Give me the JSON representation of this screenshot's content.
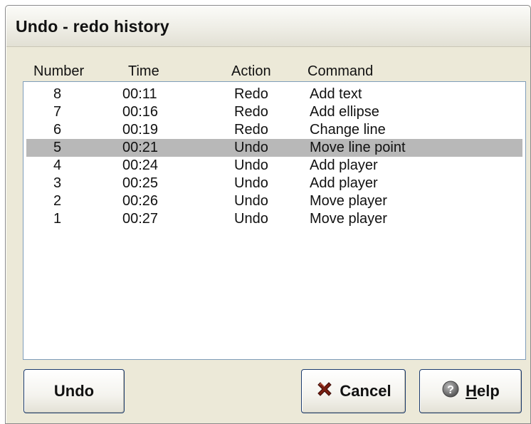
{
  "dialog": {
    "title": "Undo - redo history"
  },
  "columns": {
    "number": "Number",
    "time": "Time",
    "action": "Action",
    "command": "Command"
  },
  "rows": [
    {
      "number": "8",
      "time": "00:11",
      "action": "Redo",
      "command": "Add text"
    },
    {
      "number": "7",
      "time": "00:16",
      "action": "Redo",
      "command": "Add ellipse"
    },
    {
      "number": "6",
      "time": "00:19",
      "action": "Redo",
      "command": "Change line"
    },
    {
      "number": "5",
      "time": "00:21",
      "action": "Undo",
      "command": "Move line point",
      "selected": true
    },
    {
      "number": "4",
      "time": "00:24",
      "action": "Undo",
      "command": "Add player"
    },
    {
      "number": "3",
      "time": "00:25",
      "action": "Undo",
      "command": "Add player"
    },
    {
      "number": "2",
      "time": "00:26",
      "action": "Undo",
      "command": "Move player"
    },
    {
      "number": "1",
      "time": "00:27",
      "action": "Undo",
      "command": "Move player"
    }
  ],
  "buttons": {
    "undo": "Undo",
    "cancel": "Cancel",
    "cancel_icon": "red-x-icon",
    "help_first": "H",
    "help_rest": "elp",
    "help_icon": "question-icon"
  },
  "colors": {
    "selection": "#b8b8b8",
    "dialog_bg": "#ece9d8",
    "cancel_icon": "#7a1f12",
    "help_icon": "#6f6f6f"
  }
}
